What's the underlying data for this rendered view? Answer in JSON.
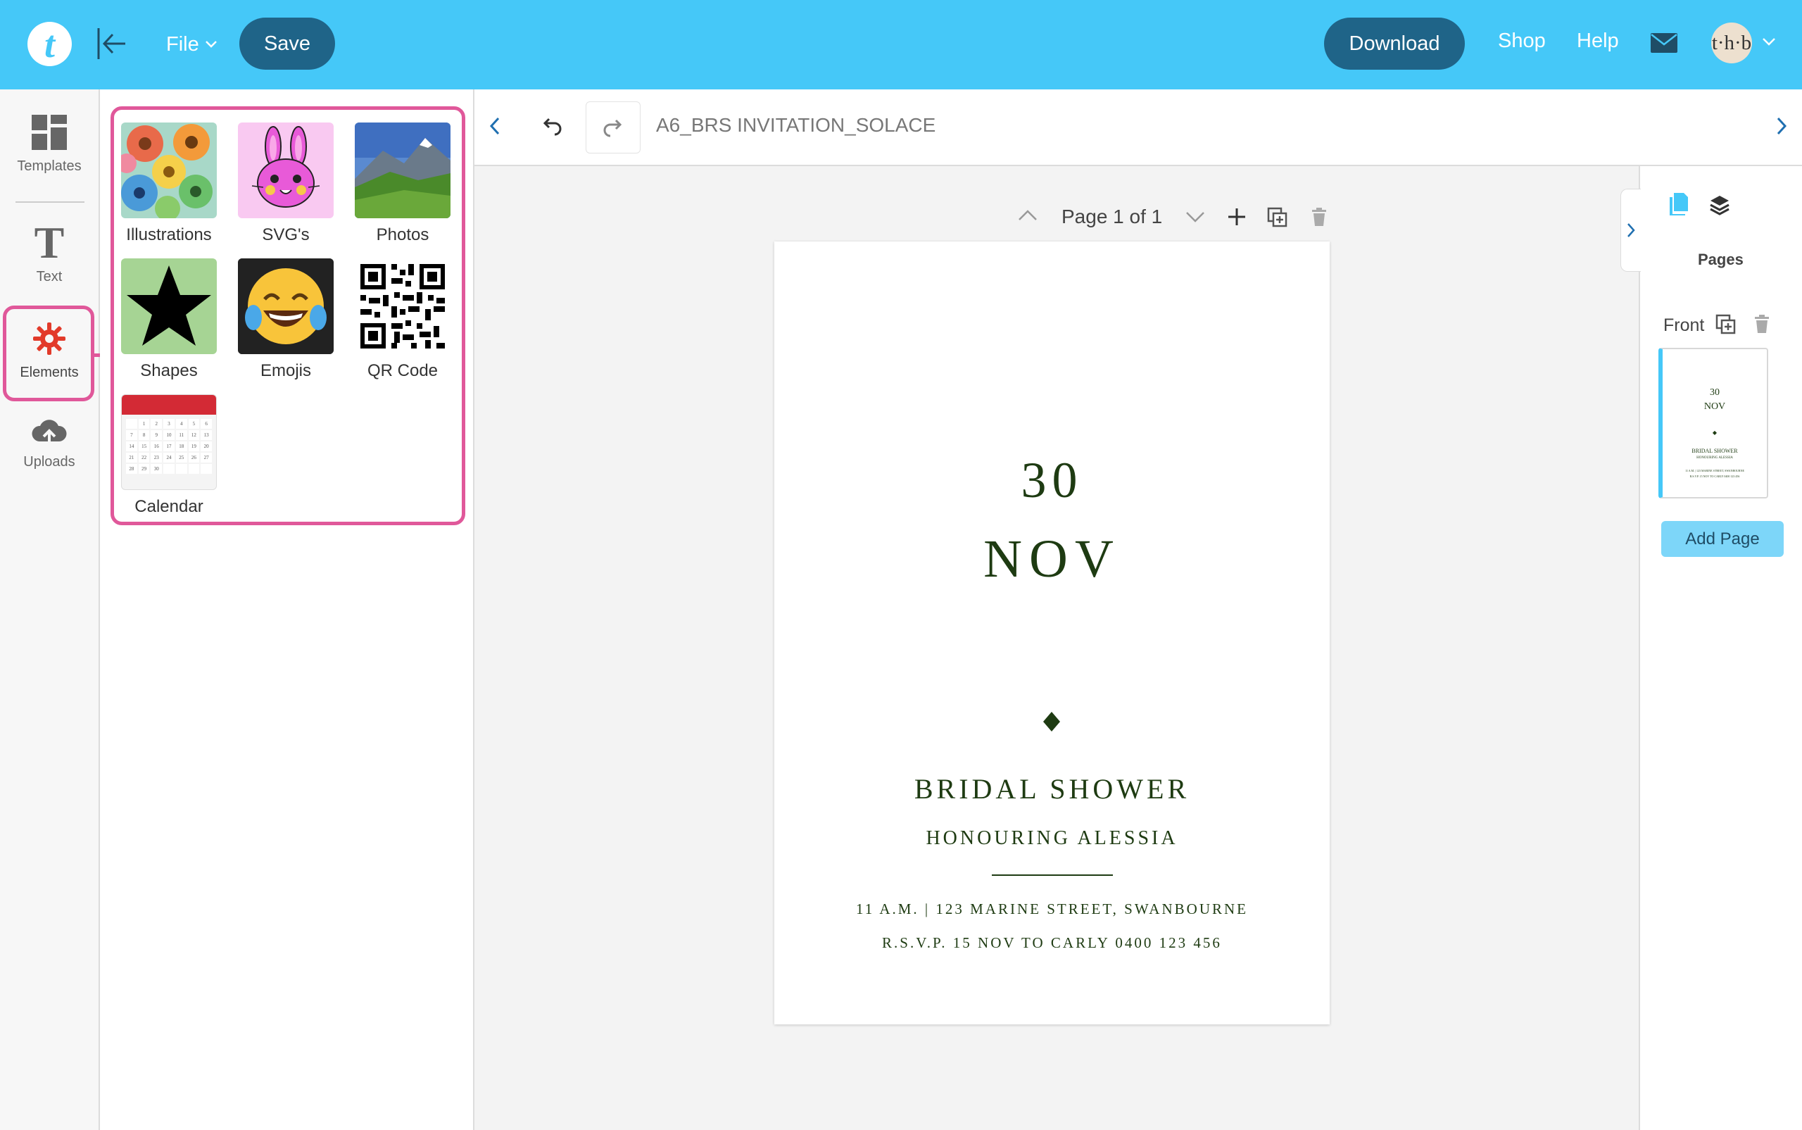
{
  "topbar": {
    "logo_letter": "t",
    "file_label": "File",
    "save_label": "Save",
    "download_label": "Download",
    "shop_label": "Shop",
    "help_label": "Help",
    "avatar_text": "t·h·b",
    "accent_color": "#45c8f8",
    "button_color": "#1f6488"
  },
  "rail": {
    "items": [
      {
        "label": "Templates",
        "icon": "templates-icon"
      },
      {
        "label": "Text",
        "icon": "text-icon"
      },
      {
        "label": "Elements",
        "icon": "elements-icon"
      },
      {
        "label": "Uploads",
        "icon": "uploads-icon"
      }
    ],
    "text_glyph": "T",
    "highlight_color": "#e0589a"
  },
  "panel": {
    "tiles": [
      {
        "label": "Illustrations",
        "icon": "flowers-illustration"
      },
      {
        "label": "SVG's",
        "icon": "bunny-svg"
      },
      {
        "label": "Photos",
        "icon": "mountain-photo"
      },
      {
        "label": "Shapes",
        "icon": "star-shape"
      },
      {
        "label": "Emojis",
        "icon": "laughing-emoji"
      },
      {
        "label": "QR Code",
        "icon": "qr-code"
      },
      {
        "label": "Calendar",
        "icon": "calendar"
      }
    ],
    "emoji": "😂",
    "calendar_days": [
      "1",
      "2",
      "3",
      "4",
      "5",
      "6",
      "7",
      "8",
      "9",
      "10",
      "11",
      "12",
      "13",
      "14",
      "15",
      "16",
      "17",
      "18",
      "19",
      "20",
      "21",
      "22",
      "23",
      "24",
      "25",
      "26",
      "27",
      "28",
      "29",
      "30"
    ]
  },
  "toolbar": {
    "document_title": "A6_BRS INVITATION_SOLACE"
  },
  "page_controls": {
    "page_label": "Page 1 of 1"
  },
  "invitation": {
    "day": "30",
    "month": "NOV",
    "event": "BRIDAL SHOWER",
    "honouree": "HONOURING ALESSIA",
    "details_line1": "11 A.M. | 123 MARINE STREET, SWANBOURNE",
    "details_line2": "R.S.V.P. 15 NOV TO CARLY 0400 123 456",
    "text_color": "#1e3b12"
  },
  "right_panel": {
    "title": "Pages",
    "front_label": "Front",
    "add_page_label": "Add Page"
  }
}
